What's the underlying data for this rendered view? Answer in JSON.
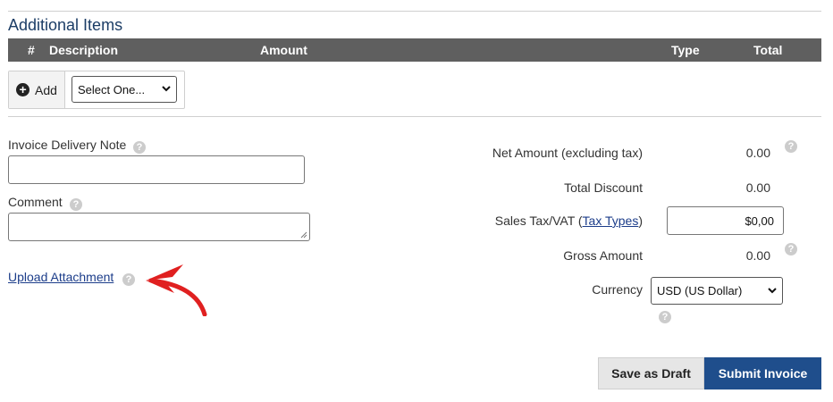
{
  "section": {
    "title": "Additional Items"
  },
  "table": {
    "headers": [
      "#",
      "Description",
      "Amount",
      "Type",
      "Total"
    ]
  },
  "add_bar": {
    "add_label": "Add",
    "select_value": "Select One..."
  },
  "form": {
    "delivery_note_label": "Invoice Delivery Note",
    "comment_label": "Comment",
    "upload_link": "Upload Attachment",
    "help_glyph": "?"
  },
  "summary": {
    "net_label": "Net Amount (excluding tax)",
    "net_value": "0.00",
    "discount_label": "Total Discount",
    "discount_value": "0.00",
    "tax_label_prefix": "Sales Tax/VAT (",
    "tax_link": "Tax Types",
    "tax_label_suffix": ")",
    "tax_value": "$0,00",
    "gross_label": "Gross Amount",
    "gross_value": "0.00",
    "currency_label": "Currency",
    "currency_value": "USD (US Dollar)"
  },
  "actions": {
    "save_draft": "Save as Draft",
    "submit": "Submit Invoice"
  },
  "colors": {
    "header_bg": "#5f5f5f",
    "primary": "#1f4e8c",
    "arrow": "#e02020",
    "title": "#1c3d66"
  },
  "icons": {
    "add": "plus-circle-icon",
    "help": "question-circle-icon",
    "caret": "chevron-down-icon",
    "annotation": "red-arrow-icon"
  }
}
